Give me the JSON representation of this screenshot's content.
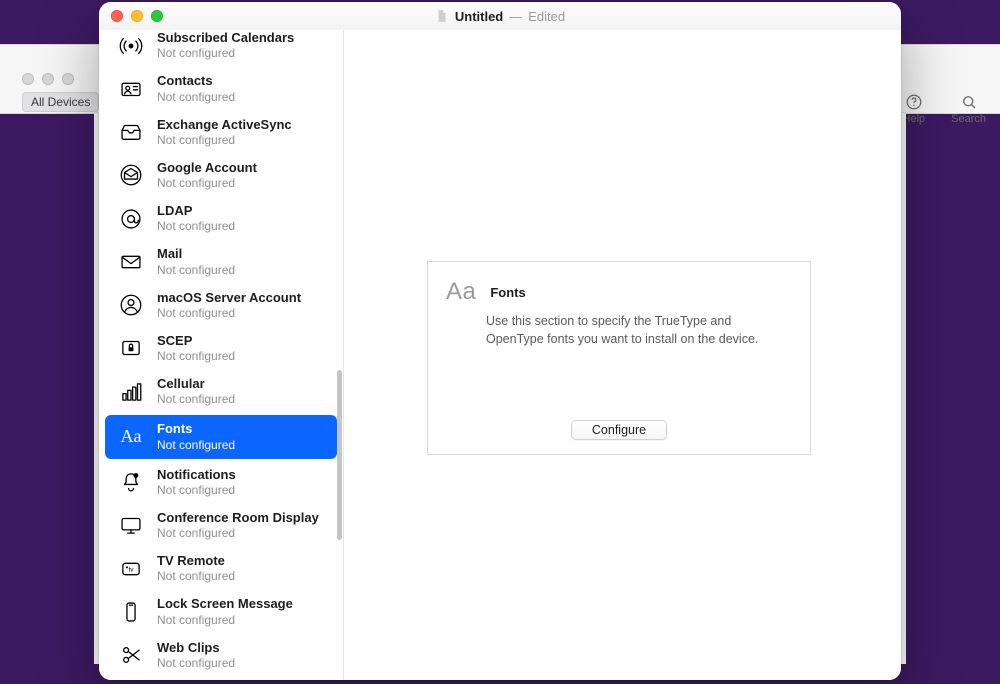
{
  "desktop": {
    "bg_toolbar": {
      "help_label": "Help",
      "search_label": "Search",
      "all_devices_chip": "All Devices"
    }
  },
  "window": {
    "document_name": "Untitled",
    "doc_state": "Edited"
  },
  "sidebar": {
    "status_not_configured": "Not configured",
    "items": [
      {
        "id": "subscribed-calendars",
        "title": "Subscribed Calendars",
        "icon": "broadcast"
      },
      {
        "id": "contacts",
        "title": "Contacts",
        "icon": "card"
      },
      {
        "id": "exchange-activesync",
        "title": "Exchange ActiveSync",
        "icon": "tray"
      },
      {
        "id": "google-account",
        "title": "Google Account",
        "icon": "sealed-envelope"
      },
      {
        "id": "ldap",
        "title": "LDAP",
        "icon": "at"
      },
      {
        "id": "mail",
        "title": "Mail",
        "icon": "envelope"
      },
      {
        "id": "macos-server",
        "title": "macOS Server Account",
        "icon": "person-circle"
      },
      {
        "id": "scep",
        "title": "SCEP",
        "icon": "lock-badge"
      },
      {
        "id": "cellular",
        "title": "Cellular",
        "icon": "bars"
      },
      {
        "id": "fonts",
        "title": "Fonts",
        "icon": "aa",
        "selected": true
      },
      {
        "id": "notifications",
        "title": "Notifications",
        "icon": "bell"
      },
      {
        "id": "conference-room",
        "title": "Conference Room Display",
        "icon": "display"
      },
      {
        "id": "tv-remote",
        "title": "TV Remote",
        "icon": "appletv"
      },
      {
        "id": "lock-screen-message",
        "title": "Lock Screen Message",
        "icon": "phone"
      },
      {
        "id": "web-clips",
        "title": "Web Clips",
        "icon": "scissors"
      }
    ]
  },
  "content": {
    "heading": "Fonts",
    "description": "Use this section to specify the TrueType and OpenType fonts you want to install on the device.",
    "configure_label": "Configure",
    "glyph": "Aa"
  }
}
